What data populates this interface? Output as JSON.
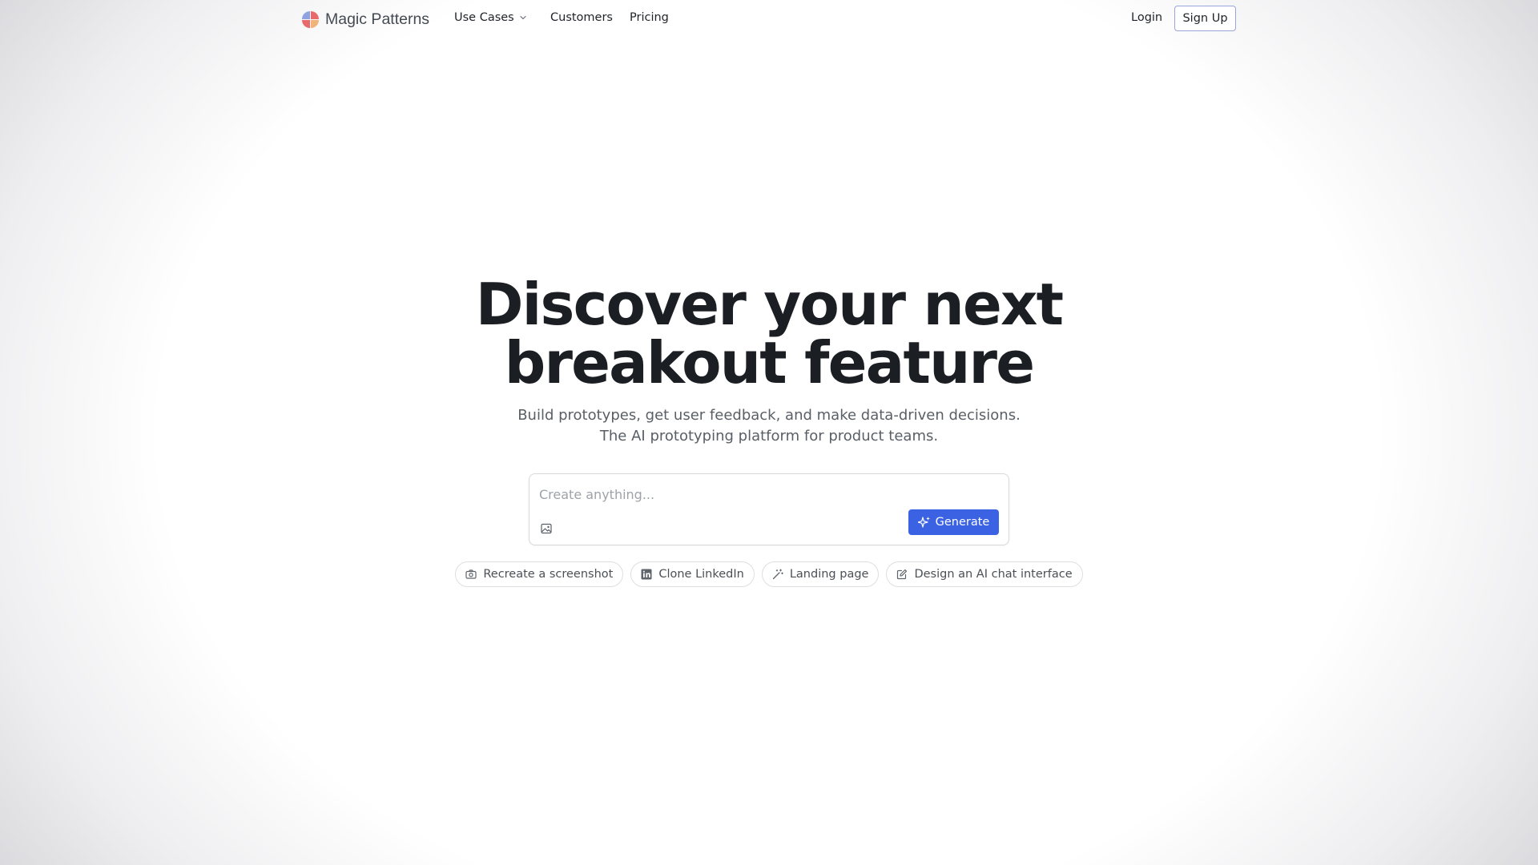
{
  "header": {
    "brand": "Magic Patterns",
    "logo_icon": "magic-patterns-logo",
    "nav": [
      {
        "label": "Use Cases",
        "icon": "chevron-down-icon"
      },
      {
        "label": "Customers"
      },
      {
        "label": "Pricing"
      }
    ],
    "login_label": "Login",
    "signup_label": "Sign Up"
  },
  "hero": {
    "headline_line1": "Discover your next",
    "headline_line2": "breakout feature",
    "subtitle_line1": "Build prototypes, get user feedback, and make data-driven decisions.",
    "subtitle_line2": "The AI prototyping platform for product teams."
  },
  "prompt": {
    "value": "",
    "placeholder": "Create anything...",
    "attach_icon": "image-icon",
    "generate_label": "Generate",
    "generate_icon": "sparkles-icon"
  },
  "suggestions": [
    {
      "label": "Recreate a screenshot",
      "icon": "camera-icon"
    },
    {
      "label": "Clone LinkedIn",
      "icon": "linkedin-icon"
    },
    {
      "label": "Landing page",
      "icon": "magic-wand-icon"
    },
    {
      "label": "Design an AI chat interface",
      "icon": "edit-icon"
    }
  ],
  "colors": {
    "accent": "#3b62e3",
    "text": "#1f2328",
    "muted_text": "#595f66",
    "logo_red": "#e86a6a",
    "logo_blue": "#8fa3e0",
    "logo_orange": "#f0b37a"
  }
}
